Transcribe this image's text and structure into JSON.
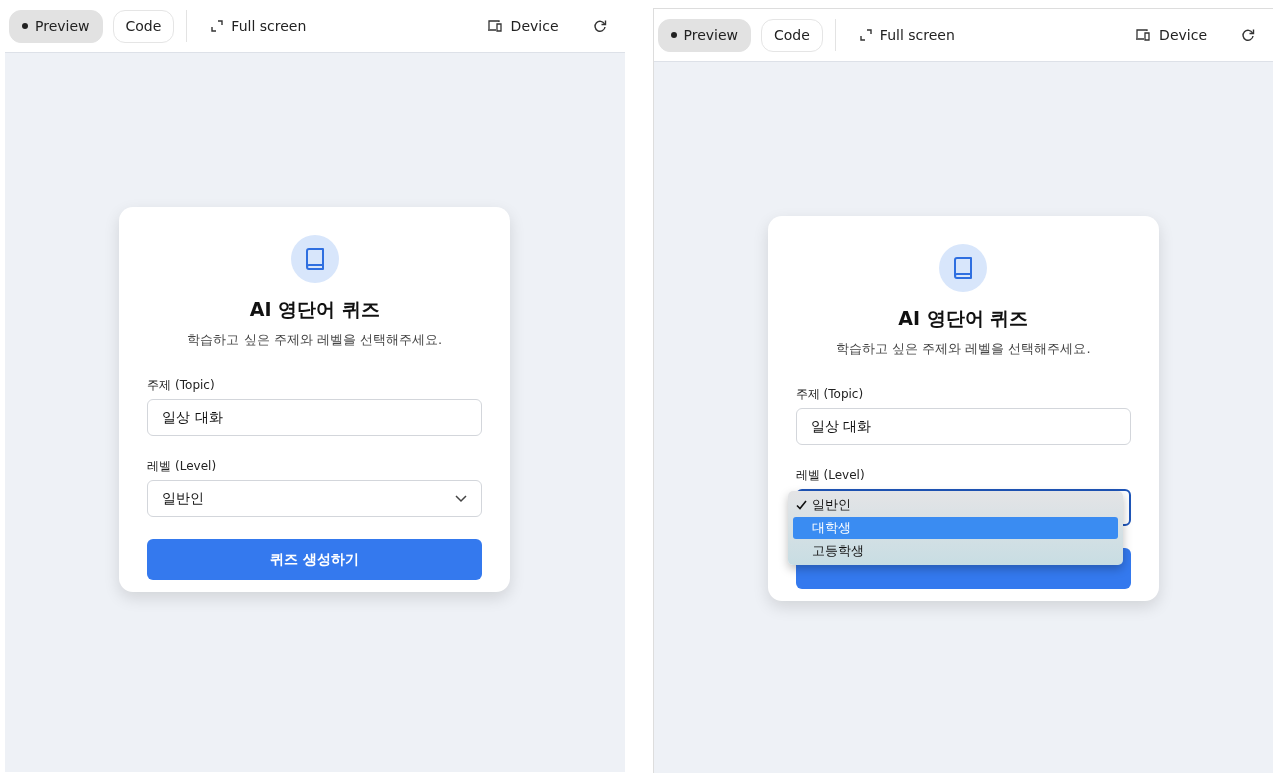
{
  "panels": [
    {
      "toolbar": {
        "tabs": [
          {
            "label": "Preview",
            "selected": true
          },
          {
            "label": "Code",
            "selected": false
          }
        ],
        "fullscreen": "Full screen",
        "device": "Device"
      },
      "card": {
        "title": "AI 영단어 퀴즈",
        "subtitle": "학습하고 싶은 주제와 레벨을 선택해주세요.",
        "topic": {
          "label": "주제 (Topic)",
          "value": "일상 대화"
        },
        "level": {
          "label": "레벨 (Level)",
          "value": "일반인",
          "focused": false,
          "open": false
        },
        "submit": {
          "label": "퀴즈 생성하기"
        }
      }
    },
    {
      "toolbar": {
        "tabs": [
          {
            "label": "Preview",
            "selected": true
          },
          {
            "label": "Code",
            "selected": false
          }
        ],
        "fullscreen": "Full screen",
        "device": "Device"
      },
      "card": {
        "title": "AI 영단어 퀴즈",
        "subtitle": "학습하고 싶은 주제와 레벨을 선택해주세요.",
        "topic": {
          "label": "주제 (Topic)",
          "value": "일상 대화"
        },
        "level": {
          "label": "레벨 (Level)",
          "focused": true,
          "open": true,
          "options": [
            {
              "label": "일반인",
              "checked": true,
              "selected": false
            },
            {
              "label": "대학생",
              "checked": false,
              "selected": true
            },
            {
              "label": "고등학생",
              "checked": false,
              "selected": false
            }
          ]
        }
      }
    }
  ]
}
